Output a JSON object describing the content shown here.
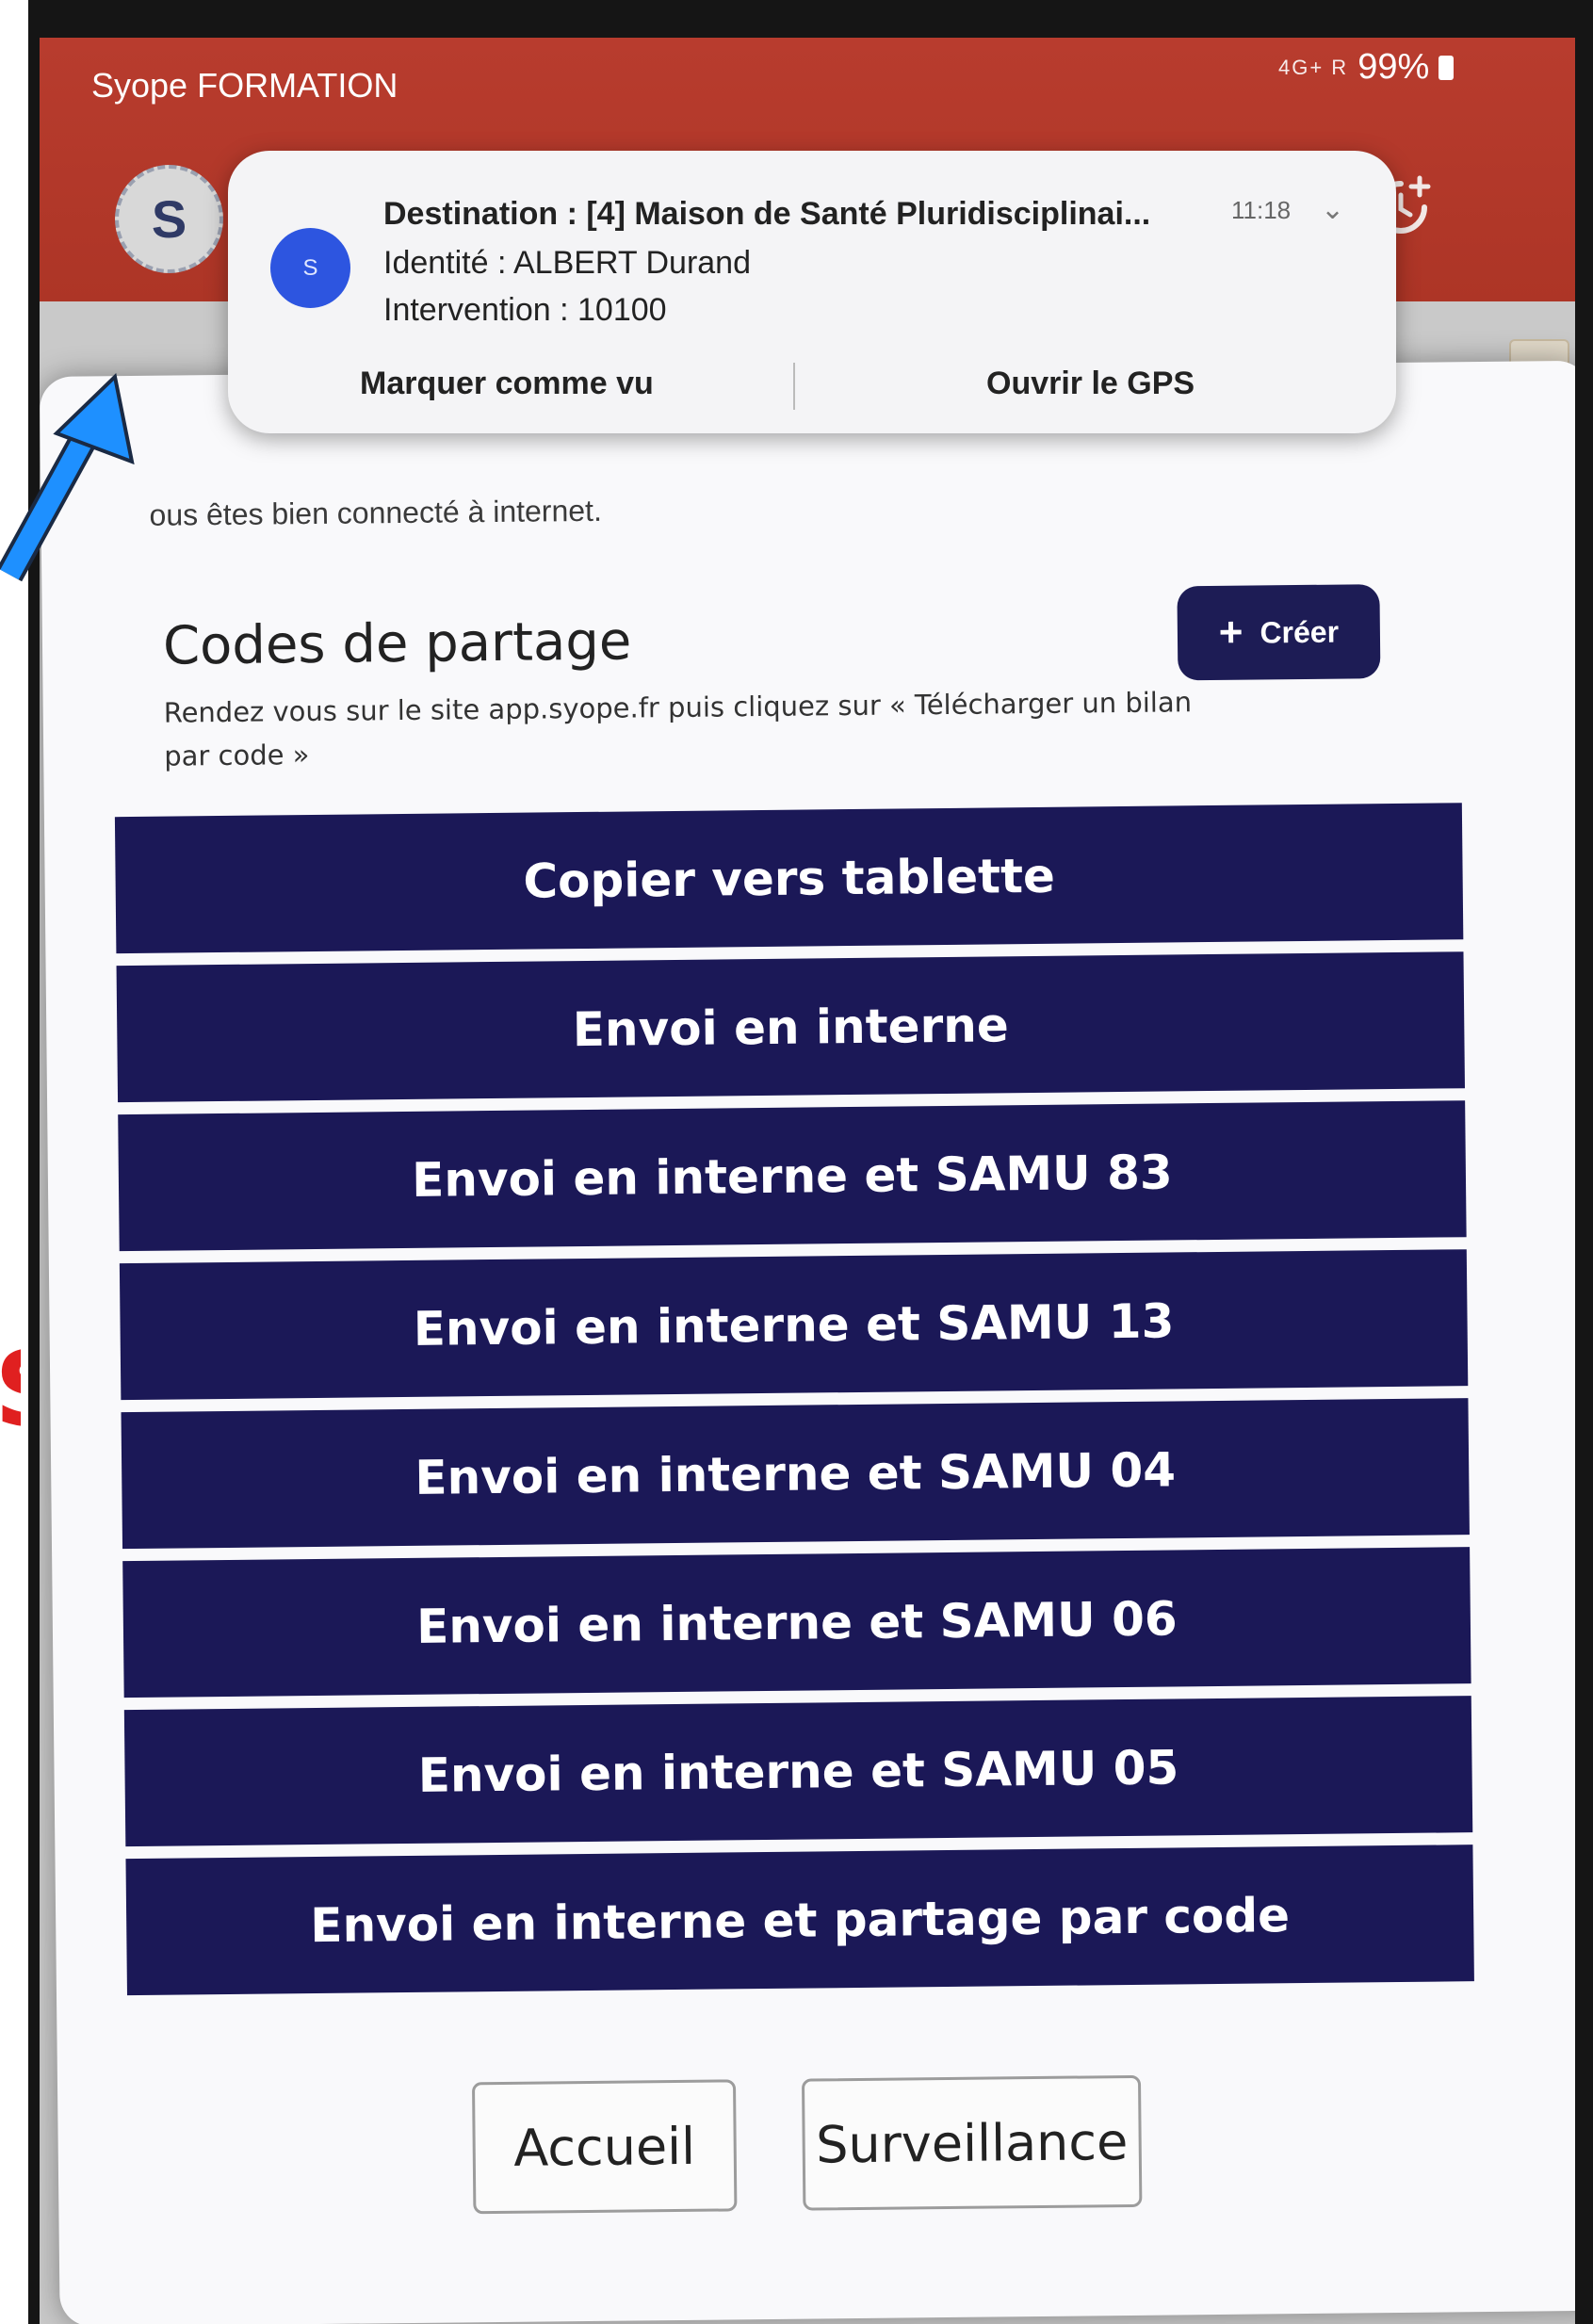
{
  "status_bar": {
    "app_name": "Syope FORMATION",
    "network_icons": "4G+ R",
    "battery": "99%"
  },
  "app_header": {
    "avatar_letter": "S"
  },
  "notification": {
    "app_icon_letter": "S",
    "destination": "Destination : [4] Maison de Santé Pluridisciplinai...",
    "time": "11:18",
    "identity": "Identité : ALBERT Durand",
    "intervention": "Intervention : 10100",
    "action_mark_seen": "Marquer comme vu",
    "action_open_gps": "Ouvrir le GPS"
  },
  "modal": {
    "connected_text": "ous êtes bien connecté à internet.",
    "codes_title": "Codes de partage",
    "codes_instructions": "Rendez vous sur le site app.syope.fr puis cliquez sur « Télécharger un bilan par code »",
    "create_label": "Créer",
    "actions": [
      "Copier vers tablette",
      "Envoi en interne",
      "Envoi en interne et SAMU 83",
      "Envoi en interne et SAMU 13",
      "Envoi en interne et SAMU 04",
      "Envoi en interne et SAMU 06",
      "Envoi en interne et SAMU 05",
      "Envoi en interne et partage par code"
    ],
    "nav_home": "Accueil",
    "nav_monitoring": "Surveillance"
  },
  "annotations": {
    "red_text": "S",
    "arrow_color": "#1e90ff",
    "red_color": "#e02020"
  },
  "colors": {
    "app_header": "#b43a2d",
    "button_navy": "#1b1857",
    "modal_bg": "#f9f9fb",
    "notification_icon": "#2d55e0"
  }
}
